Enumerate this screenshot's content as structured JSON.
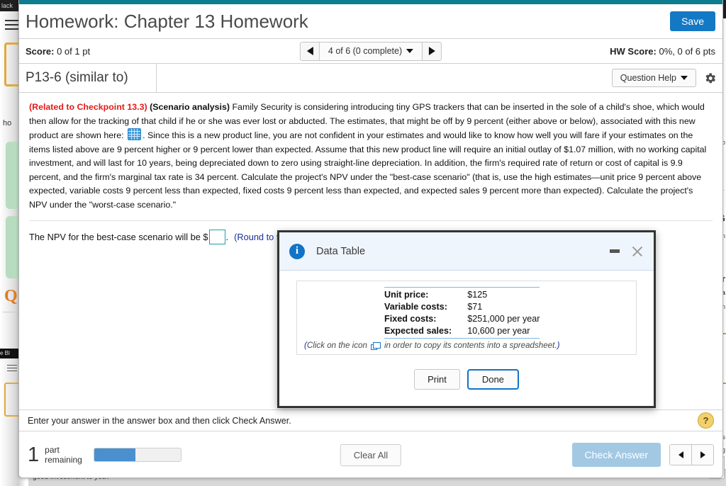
{
  "background": {
    "top_label": "lack",
    "word_fragment": "ho",
    "q_letter": "Q",
    "strip_label": "e Bl",
    "bottom_text": "good investment to you?",
    "right_fragments": [
      "o",
      "G",
      "n",
      "r",
      "a",
      "n",
      "as",
      "g"
    ]
  },
  "header": {
    "title": "Homework: Chapter 13 Homework",
    "save_label": "Save",
    "score_label": "Score:",
    "score_value": "0 of 1 pt",
    "nav_label": "4 of 6 (0 complete)",
    "hw_score_label": "HW Score:",
    "hw_score_value": "0%, 0 of 6 pts",
    "problem_id": "P13-6 (similar to)",
    "question_help_label": "Question Help",
    "gear_icon": "gear-icon",
    "prev_icon": "triangle-left-icon",
    "next_icon": "triangle-right-icon",
    "dropdown_icon": "chevron-down-icon"
  },
  "problem": {
    "checkpoint": "(Related to Checkpoint 13.3)",
    "topic": "(Scenario analysis)",
    "text_part1": "Family Security is considering introducing tiny GPS trackers that can be inserted in the sole of a child's shoe, which would then allow for the tracking of that child if he or she was ever lost or abducted.  The estimates, that might be off by 9 percent (either above or below), associated with this new product are shown  here:",
    "grid_icon": "data-table-grid-icon",
    "text_part2": ".  Since this is a new product line, you are not confident in your estimates and would like to know how well you will fare if your estimates on the items listed above are 9 percent higher or 9 percent lower than expected.  Assume that this new product line will require an initial outlay of $1.07 million, with no working capital investment, and will last for 10 years, being depreciated down to zero using straight-line depreciation.  In addition, the firm's required rate of return or cost of capital is 9.9 percent, and the firm's marginal tax rate is 34 percent.  Calculate the project's NPV under the \"best-case scenario\" (that is, use the high estimates—unit price 9 percent above expected, variable costs 9 percent less than expected, fixed costs 9 percent less than expected, and expected sales 9 percent more than expected).  Calculate the project's NPV under the \"worst-case scenario.\"",
    "answer_prompt": "The NPV for the best-case scenario will be $",
    "answer_value": "",
    "answer_suffix": ".",
    "round_note": "(Round to the nearest dollar.)"
  },
  "modal": {
    "title": "Data Table",
    "info_icon": "info-icon",
    "minimize_icon": "minimize-icon",
    "close_icon": "close-icon",
    "rows": [
      {
        "label": "Unit price:",
        "value": "$125"
      },
      {
        "label": "Variable costs:",
        "value": "$71"
      },
      {
        "label": "Fixed costs:",
        "value": "$251,000 per year"
      },
      {
        "label": "Expected sales:",
        "value": "10,600 per year"
      }
    ],
    "copy_note_open": "(",
    "copy_note_pre": "Click on the icon",
    "copy_icon": "copy-icon",
    "copy_note_post": "in order to copy its contents into a spreadsheet.",
    "copy_note_close": ")",
    "print_label": "Print",
    "done_label": "Done"
  },
  "footer": {
    "hint": "Enter your answer in the answer box and then click Check Answer.",
    "help_badge": "?",
    "parts_number": "1",
    "parts_label_line1": "part",
    "parts_label_line2": "remaining",
    "progress_percent": 48,
    "clear_all_label": "Clear All",
    "check_answer_label": "Check Answer",
    "prev_icon": "triangle-left-icon",
    "next_icon": "triangle-right-icon"
  },
  "colors": {
    "teal_bar": "#0d7e8f",
    "save_blue": "#1479c4",
    "accent_blue": "#1273c7",
    "checkpoint_red": "#e41b17",
    "link_blue": "#1c2f9c",
    "progress_blue": "#4a90cf",
    "check_answer_blue": "#a2c8e4",
    "answer_box_teal": "#1aa0b0"
  }
}
